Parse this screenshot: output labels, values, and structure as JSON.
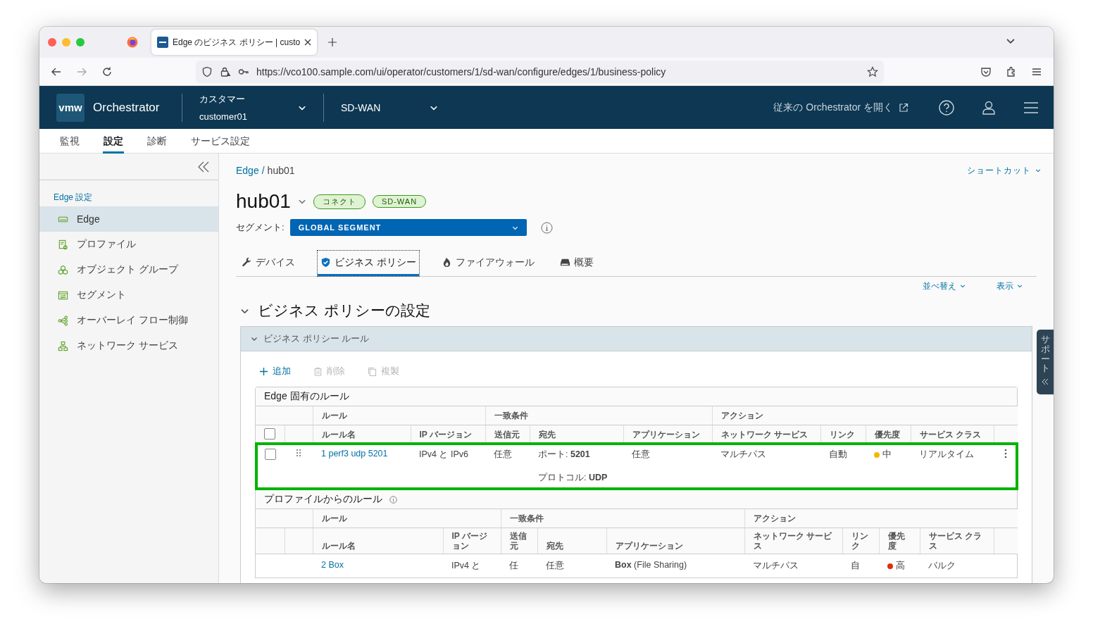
{
  "browser": {
    "tab_title": "Edge のビジネス ポリシー | custo",
    "url": "https://vco100.sample.com/ui/operator/customers/1/sd-wan/configure/edges/1/business-policy"
  },
  "header": {
    "logo": "vmw",
    "product": "Orchestrator",
    "customer_label": "カスタマー",
    "customer": "customer01",
    "service": "SD-WAN",
    "legacy_link": "従来の Orchestrator を開く"
  },
  "nav_tabs": [
    {
      "label": "監視",
      "selected": false
    },
    {
      "label": "設定",
      "selected": true
    },
    {
      "label": "診断",
      "selected": false
    },
    {
      "label": "サービス設定",
      "selected": false
    }
  ],
  "sidebar": {
    "section": "Edge 設定",
    "items": [
      {
        "label": "Edge",
        "kind": "edge",
        "selected": true
      },
      {
        "label": "プロファイル",
        "kind": "profile",
        "selected": false
      },
      {
        "label": "オブジェクト グループ",
        "kind": "objects",
        "selected": false
      },
      {
        "label": "セグメント",
        "kind": "segment",
        "selected": false
      },
      {
        "label": "オーバーレイ フロー制御",
        "kind": "overlay",
        "selected": false
      },
      {
        "label": "ネットワーク サービス",
        "kind": "network",
        "selected": false
      }
    ]
  },
  "breadcrumb": {
    "link": "Edge",
    "separator": "/",
    "current": "hub01"
  },
  "shortcut": "ショートカット",
  "edge": {
    "name": "hub01",
    "badges": [
      "コネクト",
      "SD-WAN"
    ],
    "segment_label": "セグメント:",
    "segment": "GLOBAL SEGMENT"
  },
  "tabs": [
    {
      "label": "デバイス",
      "kind": "wrench",
      "selected": false
    },
    {
      "label": "ビジネス ポリシー",
      "kind": "shield",
      "selected": true
    },
    {
      "label": "ファイアウォール",
      "kind": "flame",
      "selected": false
    },
    {
      "label": "概要",
      "kind": "drive",
      "selected": false
    }
  ],
  "view_controls": [
    "並べ替え",
    "表示"
  ],
  "section": {
    "title": "ビジネス ポリシーの設定",
    "expanded": true,
    "panel_title": "ビジネス ポリシー ルール",
    "panel_expanded": true
  },
  "actions": [
    {
      "label": "追加",
      "kind": "add",
      "disabled": false
    },
    {
      "label": "削除",
      "kind": "delete",
      "disabled": true
    },
    {
      "label": "複製",
      "kind": "clone",
      "disabled": true
    }
  ],
  "tables": [
    {
      "kind": "editable",
      "title": "Edge 固有のルール",
      "select_all": {
        "checked": false
      },
      "group_headers": [
        "ルール",
        "一致条件",
        "アクション"
      ],
      "columns": [
        "ルール名",
        "IP バージョン",
        "送信元",
        "宛先",
        "アプリケーション",
        "ネットワーク サービス",
        "リンク",
        "優先度",
        "サービス クラス"
      ],
      "rows": [
        {
          "checked": false,
          "highlighted": true,
          "rule": "1 perf3 udp 5201",
          "ip_version": "IPv4 と IPv6",
          "source": "任意",
          "destination": [
            "ポート: **5201**",
            "プロトコル: **UDP**"
          ],
          "application": "任意",
          "network_service": "マルチパス",
          "link": "自動",
          "priority": {
            "label": "中",
            "color": "#f5b800"
          },
          "service_class": "リアルタイム"
        }
      ]
    },
    {
      "kind": "inherited",
      "title": "プロファイルからのルール",
      "group_headers": [
        "ルール",
        "一致条件",
        "アクション"
      ],
      "columns": [
        "ルール名",
        "IP バージョン",
        "送信元",
        "宛先",
        "アプリケーション",
        "ネットワーク サービス",
        "リンク",
        "優先度",
        "サービス クラス"
      ],
      "rows": [
        {
          "highlighted": false,
          "rule": "2 Box",
          "ip_version": "IPv4 と",
          "source": "任",
          "destination": [
            "任意"
          ],
          "application": "**Box** (File Sharing)",
          "network_service": "マルチパス",
          "link": "自",
          "priority": {
            "label": "高",
            "color": "#e12d0a"
          },
          "service_class": "バルク"
        }
      ]
    }
  ],
  "support_tab": "サポート"
}
